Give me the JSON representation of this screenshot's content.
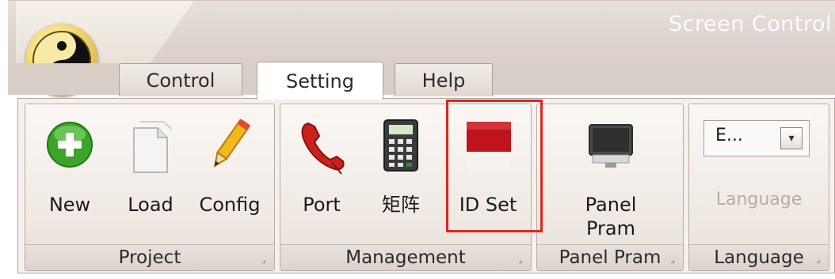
{
  "window": {
    "title": "Screen Control"
  },
  "tabs": [
    {
      "label": "Control"
    },
    {
      "label": "Setting"
    },
    {
      "label": "Help"
    }
  ],
  "groups": {
    "project": {
      "caption": "Project",
      "buttons": [
        {
          "label": "New",
          "icon": "new-icon"
        },
        {
          "label": "Load",
          "icon": "load-icon"
        },
        {
          "label": "Config",
          "icon": "config-icon"
        }
      ]
    },
    "management": {
      "caption": "Management",
      "buttons": [
        {
          "label": "Port",
          "icon": "phone-icon"
        },
        {
          "label": "矩阵",
          "icon": "matrix-icon"
        },
        {
          "label": "ID Set",
          "icon": "flag-icon"
        }
      ]
    },
    "panel_pram": {
      "caption": "Panel Pram",
      "buttons": [
        {
          "label": "Panel Pram",
          "line1": "Panel",
          "line2": "Pram",
          "icon": "monitor-icon"
        }
      ]
    },
    "language": {
      "caption": "Language",
      "combo_value": "E...",
      "label": "Language"
    }
  },
  "colors": {
    "highlight": "#e2241c",
    "new_green": "#3aa52a",
    "flag_red": "#c0141c"
  }
}
